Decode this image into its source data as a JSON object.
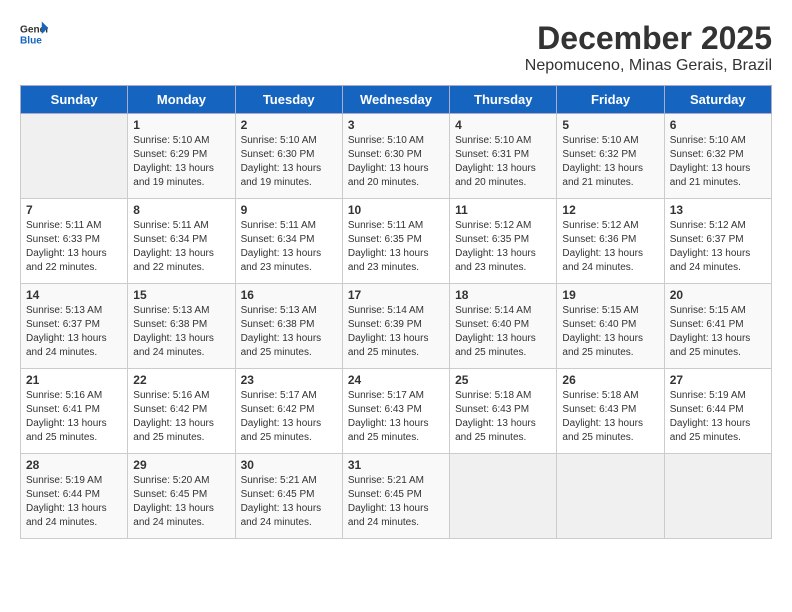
{
  "header": {
    "logo_general": "General",
    "logo_blue": "Blue",
    "title": "December 2025",
    "subtitle": "Nepomuceno, Minas Gerais, Brazil"
  },
  "days_of_week": [
    "Sunday",
    "Monday",
    "Tuesday",
    "Wednesday",
    "Thursday",
    "Friday",
    "Saturday"
  ],
  "weeks": [
    [
      {
        "day": "",
        "info": ""
      },
      {
        "day": "1",
        "info": "Sunrise: 5:10 AM\nSunset: 6:29 PM\nDaylight: 13 hours\nand 19 minutes."
      },
      {
        "day": "2",
        "info": "Sunrise: 5:10 AM\nSunset: 6:30 PM\nDaylight: 13 hours\nand 19 minutes."
      },
      {
        "day": "3",
        "info": "Sunrise: 5:10 AM\nSunset: 6:30 PM\nDaylight: 13 hours\nand 20 minutes."
      },
      {
        "day": "4",
        "info": "Sunrise: 5:10 AM\nSunset: 6:31 PM\nDaylight: 13 hours\nand 20 minutes."
      },
      {
        "day": "5",
        "info": "Sunrise: 5:10 AM\nSunset: 6:32 PM\nDaylight: 13 hours\nand 21 minutes."
      },
      {
        "day": "6",
        "info": "Sunrise: 5:10 AM\nSunset: 6:32 PM\nDaylight: 13 hours\nand 21 minutes."
      }
    ],
    [
      {
        "day": "7",
        "info": "Sunrise: 5:11 AM\nSunset: 6:33 PM\nDaylight: 13 hours\nand 22 minutes."
      },
      {
        "day": "8",
        "info": "Sunrise: 5:11 AM\nSunset: 6:34 PM\nDaylight: 13 hours\nand 22 minutes."
      },
      {
        "day": "9",
        "info": "Sunrise: 5:11 AM\nSunset: 6:34 PM\nDaylight: 13 hours\nand 23 minutes."
      },
      {
        "day": "10",
        "info": "Sunrise: 5:11 AM\nSunset: 6:35 PM\nDaylight: 13 hours\nand 23 minutes."
      },
      {
        "day": "11",
        "info": "Sunrise: 5:12 AM\nSunset: 6:35 PM\nDaylight: 13 hours\nand 23 minutes."
      },
      {
        "day": "12",
        "info": "Sunrise: 5:12 AM\nSunset: 6:36 PM\nDaylight: 13 hours\nand 24 minutes."
      },
      {
        "day": "13",
        "info": "Sunrise: 5:12 AM\nSunset: 6:37 PM\nDaylight: 13 hours\nand 24 minutes."
      }
    ],
    [
      {
        "day": "14",
        "info": "Sunrise: 5:13 AM\nSunset: 6:37 PM\nDaylight: 13 hours\nand 24 minutes."
      },
      {
        "day": "15",
        "info": "Sunrise: 5:13 AM\nSunset: 6:38 PM\nDaylight: 13 hours\nand 24 minutes."
      },
      {
        "day": "16",
        "info": "Sunrise: 5:13 AM\nSunset: 6:38 PM\nDaylight: 13 hours\nand 25 minutes."
      },
      {
        "day": "17",
        "info": "Sunrise: 5:14 AM\nSunset: 6:39 PM\nDaylight: 13 hours\nand 25 minutes."
      },
      {
        "day": "18",
        "info": "Sunrise: 5:14 AM\nSunset: 6:40 PM\nDaylight: 13 hours\nand 25 minutes."
      },
      {
        "day": "19",
        "info": "Sunrise: 5:15 AM\nSunset: 6:40 PM\nDaylight: 13 hours\nand 25 minutes."
      },
      {
        "day": "20",
        "info": "Sunrise: 5:15 AM\nSunset: 6:41 PM\nDaylight: 13 hours\nand 25 minutes."
      }
    ],
    [
      {
        "day": "21",
        "info": "Sunrise: 5:16 AM\nSunset: 6:41 PM\nDaylight: 13 hours\nand 25 minutes."
      },
      {
        "day": "22",
        "info": "Sunrise: 5:16 AM\nSunset: 6:42 PM\nDaylight: 13 hours\nand 25 minutes."
      },
      {
        "day": "23",
        "info": "Sunrise: 5:17 AM\nSunset: 6:42 PM\nDaylight: 13 hours\nand 25 minutes."
      },
      {
        "day": "24",
        "info": "Sunrise: 5:17 AM\nSunset: 6:43 PM\nDaylight: 13 hours\nand 25 minutes."
      },
      {
        "day": "25",
        "info": "Sunrise: 5:18 AM\nSunset: 6:43 PM\nDaylight: 13 hours\nand 25 minutes."
      },
      {
        "day": "26",
        "info": "Sunrise: 5:18 AM\nSunset: 6:43 PM\nDaylight: 13 hours\nand 25 minutes."
      },
      {
        "day": "27",
        "info": "Sunrise: 5:19 AM\nSunset: 6:44 PM\nDaylight: 13 hours\nand 25 minutes."
      }
    ],
    [
      {
        "day": "28",
        "info": "Sunrise: 5:19 AM\nSunset: 6:44 PM\nDaylight: 13 hours\nand 24 minutes."
      },
      {
        "day": "29",
        "info": "Sunrise: 5:20 AM\nSunset: 6:45 PM\nDaylight: 13 hours\nand 24 minutes."
      },
      {
        "day": "30",
        "info": "Sunrise: 5:21 AM\nSunset: 6:45 PM\nDaylight: 13 hours\nand 24 minutes."
      },
      {
        "day": "31",
        "info": "Sunrise: 5:21 AM\nSunset: 6:45 PM\nDaylight: 13 hours\nand 24 minutes."
      },
      {
        "day": "",
        "info": ""
      },
      {
        "day": "",
        "info": ""
      },
      {
        "day": "",
        "info": ""
      }
    ]
  ]
}
